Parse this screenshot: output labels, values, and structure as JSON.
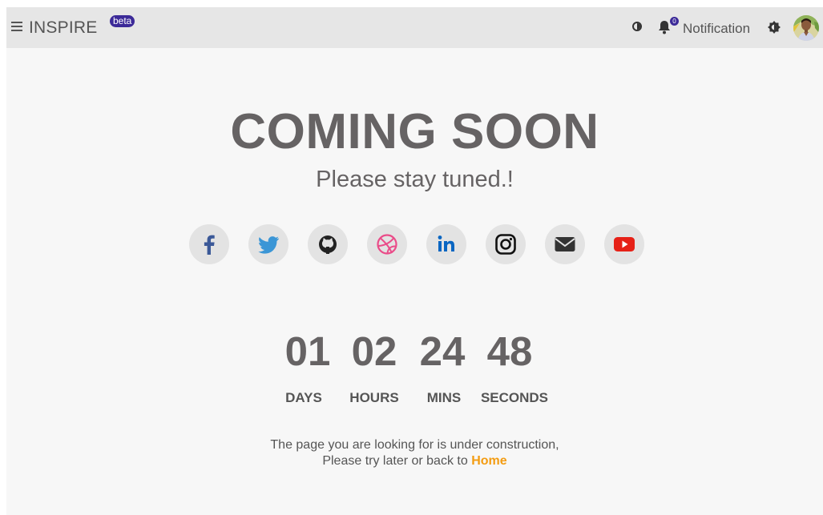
{
  "header": {
    "brand": "INSPIRE",
    "badge": "beta",
    "notification_count": "0",
    "notification_label": "Notification"
  },
  "main": {
    "title": "COMING SOON",
    "subtitle": "Please stay tuned.!",
    "social": [
      {
        "name": "facebook",
        "color": "#3b5998"
      },
      {
        "name": "twitter",
        "color": "#3b96d6"
      },
      {
        "name": "github",
        "color": "#222222"
      },
      {
        "name": "dribbble",
        "color": "#ea4c89"
      },
      {
        "name": "linkedin",
        "color": "#0a66c2"
      },
      {
        "name": "instagram",
        "color": "#111111"
      },
      {
        "name": "email",
        "color": "#333333"
      },
      {
        "name": "youtube",
        "color": "#e62117"
      }
    ],
    "countdown": {
      "days": "01",
      "hours": "02",
      "mins": "24",
      "seconds": "48",
      "days_label": "DAYS",
      "hours_label": "HOURS",
      "mins_label": "MINS",
      "seconds_label": "SECONDS"
    },
    "message_line1": "The page you are looking for is under construction,",
    "message_line2": "Please try later or back to",
    "home_link": "Home",
    "accent_color": "#f39c12"
  }
}
